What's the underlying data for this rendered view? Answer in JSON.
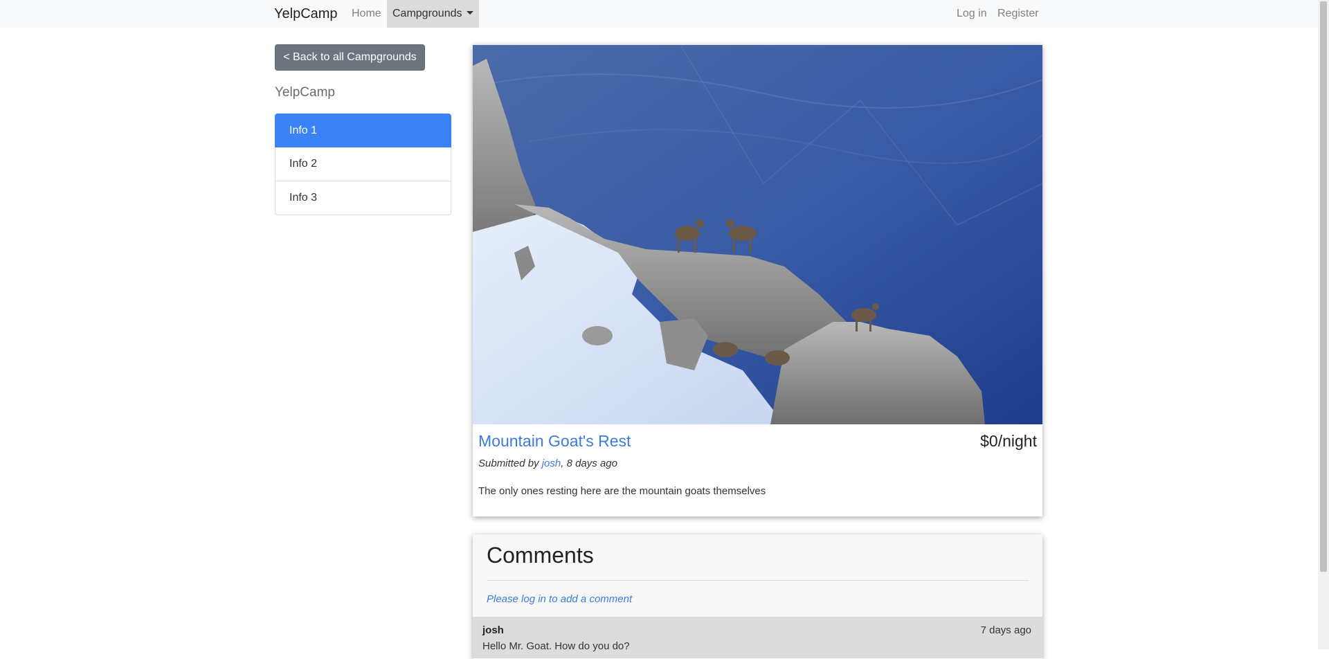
{
  "navbar": {
    "brand": "YelpCamp",
    "home": "Home",
    "campgrounds": "Campgrounds",
    "login": "Log in",
    "register": "Register"
  },
  "sidebar": {
    "back_button": "< Back to all Campgrounds",
    "title": "YelpCamp",
    "items": [
      {
        "label": "Info 1",
        "active": true
      },
      {
        "label": "Info 2",
        "active": false
      },
      {
        "label": "Info 3",
        "active": false
      }
    ]
  },
  "campground": {
    "name": "Mountain Goat's Rest",
    "price": "$0/night",
    "submitted_prefix": "Submitted by ",
    "author": "josh",
    "submitted_suffix": ", 8 days ago",
    "description": "The only ones resting here are the mountain goats themselves"
  },
  "comments": {
    "title": "Comments",
    "login_prompt": "Please log in to add a comment",
    "items": [
      {
        "author": "josh",
        "time": "7 days ago",
        "text": "Hello Mr. Goat. How do you do?"
      }
    ]
  },
  "colors": {
    "accent": "#3b82f6",
    "link": "#3b7be0",
    "secondary_button": "#6c757d"
  }
}
